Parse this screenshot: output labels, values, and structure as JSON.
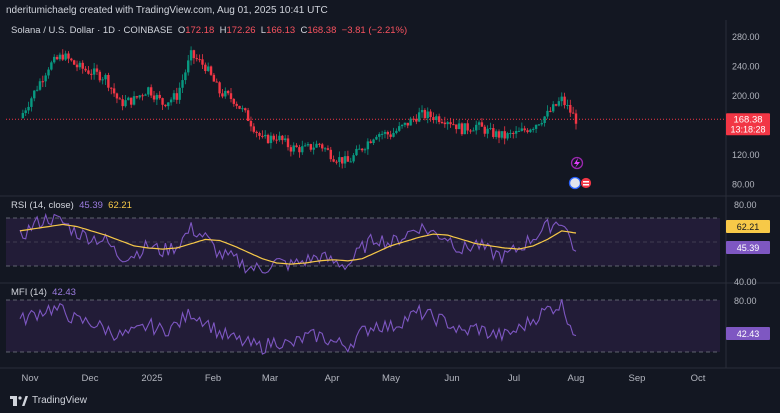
{
  "header": {
    "credit": "nderitumichaelg created with TradingView.com, Aug 01, 2025 10:41 UTC"
  },
  "symbol": {
    "name": "Solana / U.S. Dollar · 1D · COINBASE",
    "open_label": "O",
    "open": "172.18",
    "high_label": "H",
    "high": "172.26",
    "low_label": "L",
    "low": "166.13",
    "close_label": "C",
    "close": "168.38",
    "change": "−3.81 (−2.21%)"
  },
  "price_axis": {
    "ticks": [
      "280.00",
      "240.00",
      "200.00",
      "120.00",
      "80.00"
    ],
    "last_price": "168.38",
    "countdown": "13:18:28"
  },
  "rsi": {
    "label": "RSI (14, close)",
    "value": "45.39",
    "ma_value": "62.21",
    "ticks": [
      "80.00",
      "40.00"
    ]
  },
  "mfi": {
    "label": "MFI (14)",
    "value": "42.43",
    "ticks": [
      "80.00"
    ]
  },
  "time_axis": {
    "labels": [
      "Nov",
      "Dec",
      "2025",
      "Feb",
      "Mar",
      "Apr",
      "May",
      "Jun",
      "Jul",
      "Aug",
      "Sep",
      "Oct"
    ]
  },
  "footer": {
    "brand": "TradingView"
  },
  "colors": {
    "background": "#131722",
    "up": "#089981",
    "down": "#f23645",
    "rsi_line": "#7e57c2",
    "rsi_ma": "#f7c948",
    "mfi_line": "#7e57c2",
    "band_fill": "#2a2040"
  },
  "chart_data": [
    {
      "type": "candlestick",
      "title": "Solana / U.S. Dollar · 1D · COINBASE",
      "x": [
        "2024-10-27",
        "2024-11-03",
        "2024-11-10",
        "2024-11-17",
        "2024-11-24",
        "2024-12-01",
        "2024-12-08",
        "2024-12-15",
        "2024-12-22",
        "2024-12-29",
        "2025-01-05",
        "2025-01-12",
        "2025-01-19",
        "2025-01-26",
        "2025-02-02",
        "2025-02-09",
        "2025-02-16",
        "2025-02-23",
        "2025-03-02",
        "2025-03-09",
        "2025-03-16",
        "2025-03-23",
        "2025-03-30",
        "2025-04-06",
        "2025-04-13",
        "2025-04-20",
        "2025-04-27",
        "2025-05-04",
        "2025-05-11",
        "2025-05-18",
        "2025-05-25",
        "2025-06-01",
        "2025-06-08",
        "2025-06-15",
        "2025-06-22",
        "2025-06-29",
        "2025-07-06",
        "2025-07-13",
        "2025-07-20",
        "2025-07-27"
      ],
      "close": [
        170,
        205,
        240,
        255,
        240,
        232,
        225,
        190,
        195,
        210,
        190,
        200,
        255,
        240,
        205,
        195,
        170,
        140,
        145,
        130,
        128,
        135,
        118,
        110,
        130,
        150,
        148,
        160,
        175,
        172,
        168,
        155,
        160,
        150,
        145,
        150,
        160,
        175,
        195,
        168
      ],
      "ylim": [
        70,
        300
      ],
      "last_price": 168.38
    },
    {
      "type": "line",
      "series": [
        {
          "name": "RSI",
          "values": [
            58,
            70,
            76,
            72,
            62,
            58,
            55,
            40,
            42,
            50,
            45,
            50,
            66,
            58,
            42,
            38,
            30,
            28,
            35,
            32,
            36,
            40,
            35,
            32,
            48,
            58,
            52,
            60,
            68,
            62,
            58,
            46,
            52,
            44,
            40,
            48,
            58,
            68,
            74,
            45
          ]
        },
        {
          "name": "RSI-based MA",
          "values": [
            64,
            66,
            68,
            70,
            68,
            64,
            60,
            55,
            50,
            48,
            47,
            48,
            52,
            56,
            55,
            50,
            44,
            38,
            34,
            33,
            34,
            36,
            37,
            36,
            38,
            44,
            50,
            54,
            58,
            61,
            60,
            56,
            52,
            50,
            48,
            47,
            50,
            56,
            64,
            62
          ]
        }
      ],
      "ylim": [
        20,
        90
      ]
    },
    {
      "type": "line",
      "series": [
        {
          "name": "MFI",
          "values": [
            60,
            68,
            75,
            72,
            60,
            58,
            50,
            42,
            45,
            55,
            48,
            55,
            70,
            60,
            45,
            38,
            32,
            28,
            36,
            30,
            40,
            42,
            34,
            30,
            46,
            56,
            52,
            62,
            70,
            64,
            58,
            45,
            52,
            44,
            42,
            50,
            62,
            74,
            80,
            42
          ]
        }
      ],
      "ylim": [
        10,
        95
      ]
    }
  ]
}
